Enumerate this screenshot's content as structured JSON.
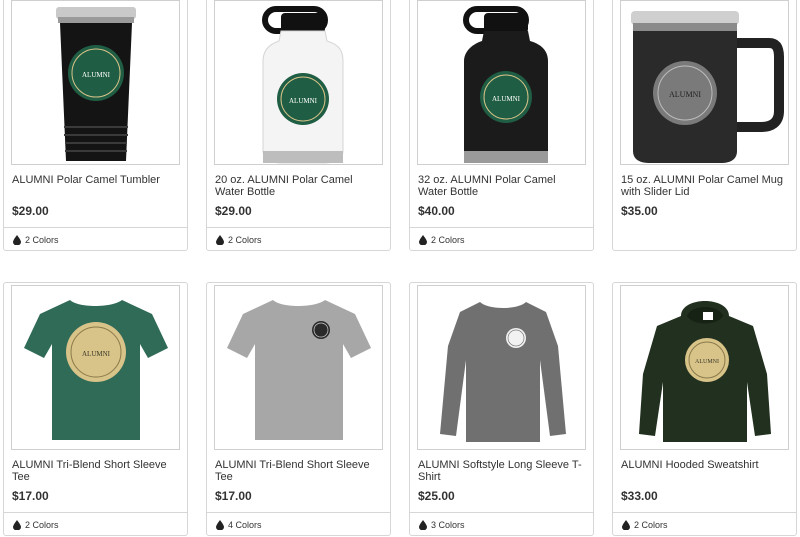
{
  "products": [
    {
      "title": "ALUMNI Polar Camel Tumbler",
      "price": "$29.00",
      "colors": "2 Colors",
      "icon": "tumbler-image"
    },
    {
      "title": "20 oz. ALUMNI Polar Camel Water Bottle",
      "price": "$29.00",
      "colors": "2 Colors",
      "icon": "white-bottle-image"
    },
    {
      "title": "32 oz. ALUMNI Polar Camel Water Bottle",
      "price": "$40.00",
      "colors": "2 Colors",
      "icon": "black-bottle-image"
    },
    {
      "title": "15 oz. ALUMNI Polar Camel Mug with Slider Lid",
      "price": "$35.00",
      "colors": "",
      "icon": "mug-image"
    },
    {
      "title": "ALUMNI Tri-Blend Short Sleeve Tee",
      "price": "$17.00",
      "colors": "2 Colors",
      "icon": "green-tee-image"
    },
    {
      "title": "ALUMNI Tri-Blend Short Sleeve Tee",
      "price": "$17.00",
      "colors": "4 Colors",
      "icon": "grey-tee-image"
    },
    {
      "title": "ALUMNI Softstyle Long Sleeve T-Shirt",
      "price": "$25.00",
      "colors": "3 Colors",
      "icon": "longsleeve-image"
    },
    {
      "title": "ALUMNI Hooded Sweatshirt",
      "price": "$33.00",
      "colors": "2 Colors",
      "icon": "hoodie-image"
    }
  ],
  "logo_text": "ALUMNI",
  "colors_used": {
    "logo_green": "#1f5e44",
    "logo_gold": "#d8c389",
    "tee_green": "#2f6b56",
    "tee_grey": "#a7a7a7",
    "shirt_grey": "#707070",
    "hoodie": "#22311f"
  }
}
